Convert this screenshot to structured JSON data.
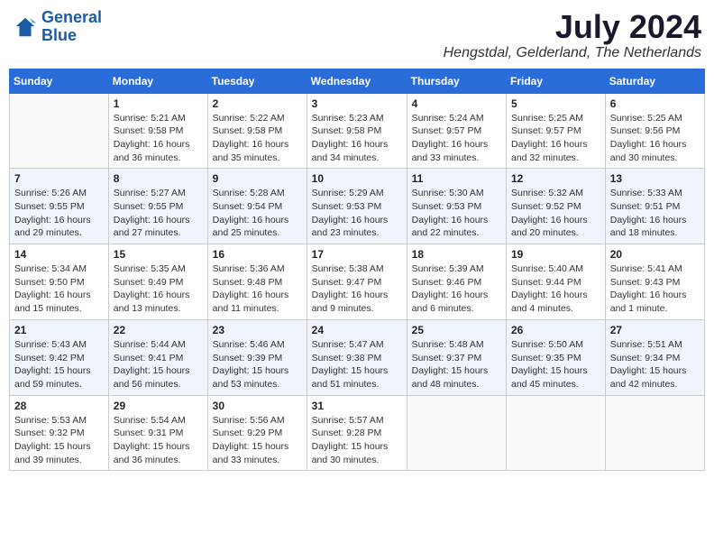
{
  "logo": {
    "line1": "General",
    "line2": "Blue"
  },
  "title": "July 2024",
  "location": "Hengstdal, Gelderland, The Netherlands",
  "headers": [
    "Sunday",
    "Monday",
    "Tuesday",
    "Wednesday",
    "Thursday",
    "Friday",
    "Saturday"
  ],
  "weeks": [
    [
      {
        "day": "",
        "info": ""
      },
      {
        "day": "1",
        "info": "Sunrise: 5:21 AM\nSunset: 9:58 PM\nDaylight: 16 hours\nand 36 minutes."
      },
      {
        "day": "2",
        "info": "Sunrise: 5:22 AM\nSunset: 9:58 PM\nDaylight: 16 hours\nand 35 minutes."
      },
      {
        "day": "3",
        "info": "Sunrise: 5:23 AM\nSunset: 9:58 PM\nDaylight: 16 hours\nand 34 minutes."
      },
      {
        "day": "4",
        "info": "Sunrise: 5:24 AM\nSunset: 9:57 PM\nDaylight: 16 hours\nand 33 minutes."
      },
      {
        "day": "5",
        "info": "Sunrise: 5:25 AM\nSunset: 9:57 PM\nDaylight: 16 hours\nand 32 minutes."
      },
      {
        "day": "6",
        "info": "Sunrise: 5:25 AM\nSunset: 9:56 PM\nDaylight: 16 hours\nand 30 minutes."
      }
    ],
    [
      {
        "day": "7",
        "info": "Sunrise: 5:26 AM\nSunset: 9:55 PM\nDaylight: 16 hours\nand 29 minutes."
      },
      {
        "day": "8",
        "info": "Sunrise: 5:27 AM\nSunset: 9:55 PM\nDaylight: 16 hours\nand 27 minutes."
      },
      {
        "day": "9",
        "info": "Sunrise: 5:28 AM\nSunset: 9:54 PM\nDaylight: 16 hours\nand 25 minutes."
      },
      {
        "day": "10",
        "info": "Sunrise: 5:29 AM\nSunset: 9:53 PM\nDaylight: 16 hours\nand 23 minutes."
      },
      {
        "day": "11",
        "info": "Sunrise: 5:30 AM\nSunset: 9:53 PM\nDaylight: 16 hours\nand 22 minutes."
      },
      {
        "day": "12",
        "info": "Sunrise: 5:32 AM\nSunset: 9:52 PM\nDaylight: 16 hours\nand 20 minutes."
      },
      {
        "day": "13",
        "info": "Sunrise: 5:33 AM\nSunset: 9:51 PM\nDaylight: 16 hours\nand 18 minutes."
      }
    ],
    [
      {
        "day": "14",
        "info": "Sunrise: 5:34 AM\nSunset: 9:50 PM\nDaylight: 16 hours\nand 15 minutes."
      },
      {
        "day": "15",
        "info": "Sunrise: 5:35 AM\nSunset: 9:49 PM\nDaylight: 16 hours\nand 13 minutes."
      },
      {
        "day": "16",
        "info": "Sunrise: 5:36 AM\nSunset: 9:48 PM\nDaylight: 16 hours\nand 11 minutes."
      },
      {
        "day": "17",
        "info": "Sunrise: 5:38 AM\nSunset: 9:47 PM\nDaylight: 16 hours\nand 9 minutes."
      },
      {
        "day": "18",
        "info": "Sunrise: 5:39 AM\nSunset: 9:46 PM\nDaylight: 16 hours\nand 6 minutes."
      },
      {
        "day": "19",
        "info": "Sunrise: 5:40 AM\nSunset: 9:44 PM\nDaylight: 16 hours\nand 4 minutes."
      },
      {
        "day": "20",
        "info": "Sunrise: 5:41 AM\nSunset: 9:43 PM\nDaylight: 16 hours\nand 1 minute."
      }
    ],
    [
      {
        "day": "21",
        "info": "Sunrise: 5:43 AM\nSunset: 9:42 PM\nDaylight: 15 hours\nand 59 minutes."
      },
      {
        "day": "22",
        "info": "Sunrise: 5:44 AM\nSunset: 9:41 PM\nDaylight: 15 hours\nand 56 minutes."
      },
      {
        "day": "23",
        "info": "Sunrise: 5:46 AM\nSunset: 9:39 PM\nDaylight: 15 hours\nand 53 minutes."
      },
      {
        "day": "24",
        "info": "Sunrise: 5:47 AM\nSunset: 9:38 PM\nDaylight: 15 hours\nand 51 minutes."
      },
      {
        "day": "25",
        "info": "Sunrise: 5:48 AM\nSunset: 9:37 PM\nDaylight: 15 hours\nand 48 minutes."
      },
      {
        "day": "26",
        "info": "Sunrise: 5:50 AM\nSunset: 9:35 PM\nDaylight: 15 hours\nand 45 minutes."
      },
      {
        "day": "27",
        "info": "Sunrise: 5:51 AM\nSunset: 9:34 PM\nDaylight: 15 hours\nand 42 minutes."
      }
    ],
    [
      {
        "day": "28",
        "info": "Sunrise: 5:53 AM\nSunset: 9:32 PM\nDaylight: 15 hours\nand 39 minutes."
      },
      {
        "day": "29",
        "info": "Sunrise: 5:54 AM\nSunset: 9:31 PM\nDaylight: 15 hours\nand 36 minutes."
      },
      {
        "day": "30",
        "info": "Sunrise: 5:56 AM\nSunset: 9:29 PM\nDaylight: 15 hours\nand 33 minutes."
      },
      {
        "day": "31",
        "info": "Sunrise: 5:57 AM\nSunset: 9:28 PM\nDaylight: 15 hours\nand 30 minutes."
      },
      {
        "day": "",
        "info": ""
      },
      {
        "day": "",
        "info": ""
      },
      {
        "day": "",
        "info": ""
      }
    ]
  ]
}
